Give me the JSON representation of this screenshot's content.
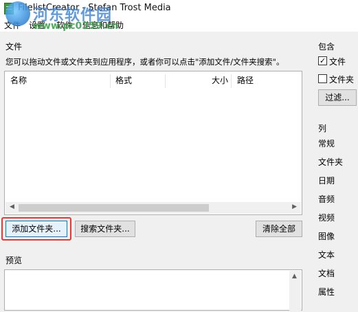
{
  "window": {
    "title": "FilelistCreator - Stefan Trost Media"
  },
  "menu": {
    "items": [
      "文件",
      "设置",
      "软件",
      "信息和帮助"
    ]
  },
  "watermark": {
    "site_name": "河东软件园",
    "url": "www.pc0359.cn"
  },
  "files_section": {
    "label": "文件",
    "hint": "您可以拖动文件或文件夹到应用程序，或者你可以点击\"添加文件/文件夹搜索\"。",
    "columns": [
      "名称",
      "格式",
      "大小",
      "路径"
    ]
  },
  "buttons": {
    "add_folder": "添加文件夹...",
    "search_folder": "搜索文件夹...",
    "clear_all": "清除全部"
  },
  "preview": {
    "label": "预览"
  },
  "include": {
    "label": "包含",
    "files": {
      "label": "文件",
      "checked": true
    },
    "folders": {
      "label": "文件夹",
      "checked": false
    },
    "filter_button": "过滤..."
  },
  "columns_panel": {
    "label": "列",
    "items": [
      "常规",
      "文件夹",
      "日期",
      "音频",
      "视频",
      "图像",
      "文本",
      "文档",
      "属性"
    ]
  },
  "colors": {
    "highlight": "#e53935",
    "focus": "#0078d7"
  }
}
